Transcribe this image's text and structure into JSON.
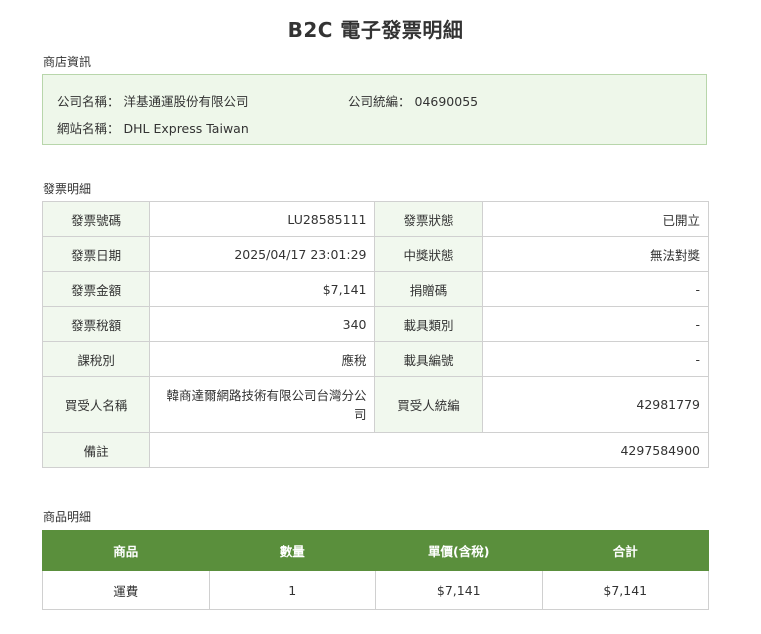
{
  "title": "B2C 電子發票明細",
  "store_section": {
    "label": "商店資訊",
    "company_name_label": "公司名稱：",
    "company_name": "洋基通運股份有限公司",
    "tax_id_label": "公司統編：",
    "tax_id": "04690055",
    "site_name_label": "網站名稱：",
    "site_name": "DHL Express Taiwan"
  },
  "invoice_section": {
    "label": "發票明細",
    "rows": [
      {
        "k1": "發票號碼",
        "v1": "LU28585111",
        "k2": "發票狀態",
        "v2": "已開立"
      },
      {
        "k1": "發票日期",
        "v1": "2025/04/17 23:01:29",
        "k2": "中獎狀態",
        "v2": "無法對獎"
      },
      {
        "k1": "發票金額",
        "v1": "$7,141",
        "k2": "捐贈碼",
        "v2": "-"
      },
      {
        "k1": "發票稅額",
        "v1": "340",
        "k2": "載具類別",
        "v2": "-"
      },
      {
        "k1": "課稅別",
        "v1": "應稅",
        "k2": "載具編號",
        "v2": "-"
      },
      {
        "k1": "買受人名稱",
        "v1": "韓商達爾網路技術有限公司台灣分公司",
        "k2": "買受人統編",
        "v2": "42981779"
      }
    ],
    "remark_label": "備註",
    "remark_value": "4297584900"
  },
  "goods_section": {
    "label": "商品明細",
    "headers": [
      "商品",
      "數量",
      "單價(含稅)",
      "合計"
    ],
    "rows": [
      [
        "運費",
        "1",
        "$7,141",
        "$7,141"
      ]
    ]
  },
  "colors": {
    "header_green": "#5a8f3c",
    "label_bg": "#f1f8ee",
    "store_box_bg": "#eef7ea",
    "store_box_border": "#b8d6ab"
  }
}
